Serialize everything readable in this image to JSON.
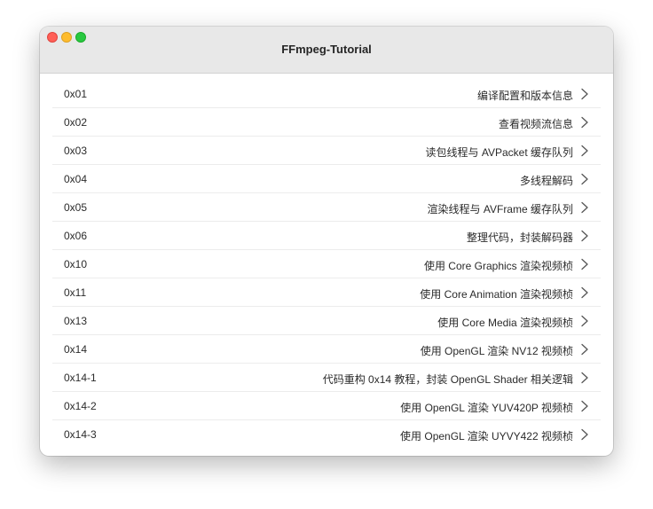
{
  "window": {
    "title": "FFmpeg-Tutorial"
  },
  "colors": {
    "close": "#ff5f57",
    "minimize": "#febc2e",
    "maximize": "#28c840",
    "titlebar": "#e8e8e8"
  },
  "icons": {
    "row_accessory": "chevron-right-icon"
  },
  "items": [
    {
      "id": "0x01",
      "label": "编译配置和版本信息"
    },
    {
      "id": "0x02",
      "label": "查看视频流信息"
    },
    {
      "id": "0x03",
      "label": "读包线程与 AVPacket 缓存队列"
    },
    {
      "id": "0x04",
      "label": "多线程解码"
    },
    {
      "id": "0x05",
      "label": "渲染线程与 AVFrame 缓存队列"
    },
    {
      "id": "0x06",
      "label": "整理代码，封装解码器"
    },
    {
      "id": "0x10",
      "label": "使用 Core Graphics 渲染视频桢"
    },
    {
      "id": "0x11",
      "label": "使用 Core Animation 渲染视频桢"
    },
    {
      "id": "0x13",
      "label": "使用 Core Media 渲染视频桢"
    },
    {
      "id": "0x14",
      "label": "使用 OpenGL 渲染 NV12 视频桢"
    },
    {
      "id": "0x14-1",
      "label": "代码重构 0x14 教程，封装 OpenGL Shader 相关逻辑"
    },
    {
      "id": "0x14-2",
      "label": "使用 OpenGL 渲染 YUV420P 视频桢"
    },
    {
      "id": "0x14-3",
      "label": "使用 OpenGL 渲染 UYVY422 视频桢"
    }
  ]
}
